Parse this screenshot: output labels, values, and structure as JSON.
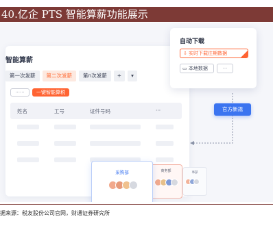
{
  "slide": {
    "title": "40.亿企 PTS 智能算薪功能展示",
    "source": "据来源：税友股份公司官网，财通证券研究所"
  },
  "main": {
    "title": "智能算薪",
    "tabs": [
      {
        "label": "第一次发薪",
        "active": false
      },
      {
        "label": "第二次发薪",
        "active": true
      },
      {
        "label": "第n次发薪",
        "active": false
      },
      {
        "label": "+",
        "active": false
      },
      {
        "label": "▾",
        "active": false
      }
    ],
    "more_label": "······",
    "calc_button": "一键智能算税",
    "table": {
      "headers": [
        "姓名",
        "工号",
        "证件号码",
        "···"
      ]
    }
  },
  "download": {
    "title": "自动下载",
    "realtime_label": "实时下载往期数据",
    "local_label": "本地数据",
    "more_label": "···"
  },
  "official_button": "官方新规",
  "departments": {
    "purchase": "采购部",
    "business": "商务部",
    "third": "事部"
  },
  "colors": {
    "title_bar": "#7d3a36",
    "accent_orange": "#ff6433",
    "accent_blue": "#3b74f0"
  }
}
